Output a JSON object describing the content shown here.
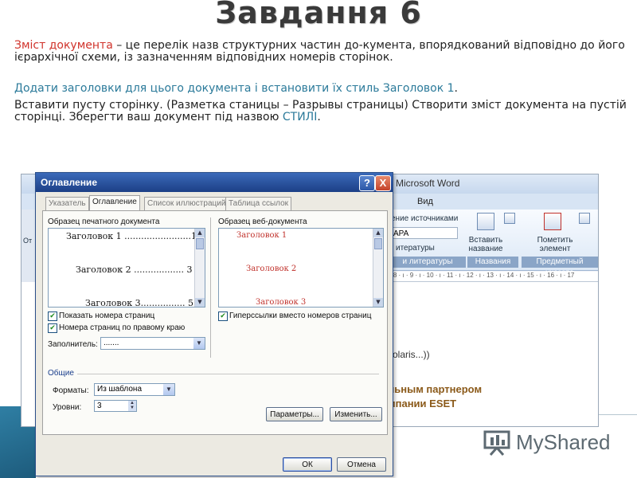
{
  "slide": {
    "title": "Завдання 6",
    "p1_term": "Зміст документа",
    "p1_rest": " – це перелік назв структурних частин до-кумента, впорядкований відповідно до його ієрархічної схеми, із зазначенням відповідних номерів сторінок.",
    "p2": "Додати заголовки для цього документа і встановити їх стиль Заголовок 1",
    "p2_end": ".",
    "p3": "Вставити пусту сторінку. (Разметка станицы – Разрывы страницы)   Створити зміст документа на пустій сторінці. Зберегти ваш документ під назвою ",
    "p3_name": "СТИЛІ",
    "p3_end": "."
  },
  "word": {
    "title": "Microsoft Word",
    "menu_vid": "Вид",
    "ribbon_sources": "ение источниками",
    "ribbon_style": "APA",
    "ribbon_literature_btn": "итературы",
    "ribbon_group_literature": "и литературы",
    "insert_caption": "Вставить название",
    "mark_entry": "Пометить элемент",
    "group_captions": "Названия",
    "group_index": "Предметный указате",
    "ruler_ticks": "· 8 · ı · 9 · ı · 10 · ı · 11 · ı · 12 · ı · 13 · ı · 14 · ı · 15 · ı · 16 · ı · 17",
    "doc_solaris": "Solaris...))",
    "doc_partner_1": "льным партнером",
    "doc_partner_2": "мпании ESET",
    "left_letter": "От"
  },
  "dialog": {
    "title": "Оглавление",
    "help_label": "?",
    "close_label": "X",
    "tabs": [
      "Указатель",
      "Оглавление",
      "Список иллюстраций",
      "Таблица ссылок"
    ],
    "print_preview_label": "Образец печатного документа",
    "print_lines": [
      "Заголовок 1 ........................1",
      "Заголовок 2 .................. 3",
      "Заголовок 3................ 5"
    ],
    "web_preview_label": "Образец веб-документа",
    "web_lines": [
      "Заголовок 1",
      "Заголовок 2",
      "Заголовок 3"
    ],
    "show_page_numbers": "Показать номера страниц",
    "right_align": "Номера страниц по правому краю",
    "hyperlinks": "Гиперссылки вместо номеров страниц",
    "tab_leader_label": "Заполнитель:",
    "tab_leader_value": ".......",
    "general_label": "Общие",
    "formats_label": "Форматы:",
    "formats_value": "Из шаблона",
    "levels_label": "Уровни:",
    "levels_value": "3",
    "options_button": "Параметры...",
    "modify_button": "Изменить...",
    "ok_button": "ОК",
    "cancel_button": "Отмена"
  },
  "logo": {
    "text": "MyShared"
  },
  "colors": {
    "accent_red": "#d0332b",
    "accent_teal": "#2b7a9a",
    "dialog_title": "#1c3f86"
  }
}
